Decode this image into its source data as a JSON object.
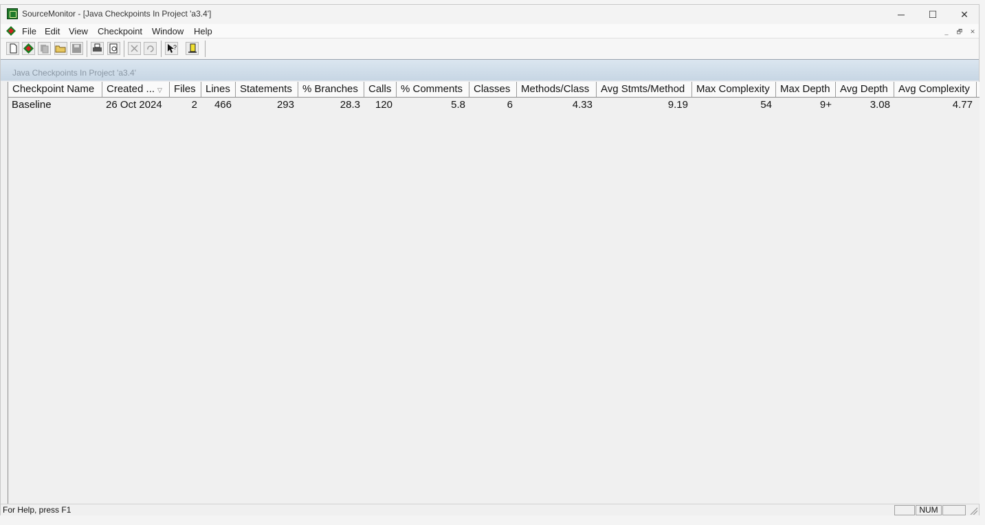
{
  "window": {
    "title": "SourceMonitor - [Java Checkpoints In Project 'a3.4']",
    "controls": {
      "minimize": "─",
      "maximize": "☐",
      "close": "✕"
    }
  },
  "menu": {
    "items": [
      "File",
      "Edit",
      "View",
      "Checkpoint",
      "Window",
      "Help"
    ],
    "mdi_controls": [
      "_",
      "🗗",
      "✕"
    ]
  },
  "toolbar": {
    "buttons": [
      "new-icon",
      "checkpoint-icon",
      "copy-icon",
      "open-icon",
      "save-icon",
      "print-icon",
      "print-preview-icon",
      "delete-icon",
      "undo-icon",
      "context-help-icon",
      "bookmark-icon"
    ]
  },
  "content": {
    "title": "Java Checkpoints In Project 'a3.4'"
  },
  "table": {
    "columns": [
      "Checkpoint Name",
      "Created ...",
      "Files",
      "Lines",
      "Statements",
      "% Branches",
      "Calls",
      "% Comments",
      "Classes",
      "Methods/Class",
      "Avg Stmts/Method",
      "Max Complexity",
      "Max Depth",
      "Avg Depth",
      "Avg Complexity"
    ],
    "sort_indicator": "▽",
    "rows": [
      [
        "Baseline",
        "26 Oct 2024",
        "2",
        "466",
        "293",
        "28.3",
        "120",
        "5.8",
        "6",
        "4.33",
        "9.19",
        "54",
        "9+",
        "3.08",
        "4.77"
      ]
    ]
  },
  "status": {
    "help_text": "For Help, press F1",
    "num_indicator": "NUM"
  }
}
